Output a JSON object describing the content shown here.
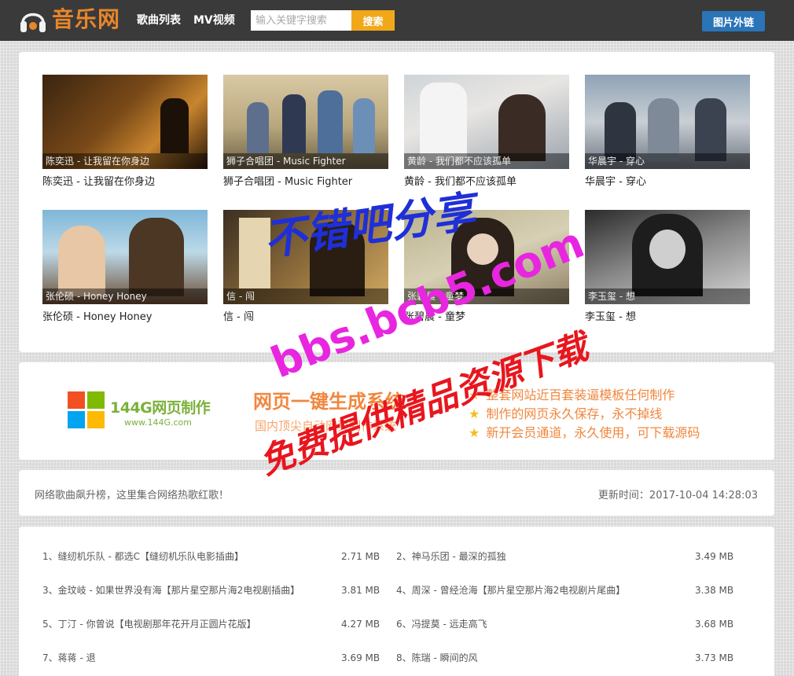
{
  "header": {
    "logo_text": "音乐网",
    "nav": [
      "歌曲列表",
      "MV视频"
    ],
    "search_placeholder": "输入关键字搜索",
    "search_button": "搜索",
    "img_link_button": "图片外链"
  },
  "gallery": [
    {
      "caption": "陈奕迅 - 让我留在你身边",
      "title": "陈奕迅 - 让我留在你身边"
    },
    {
      "caption": "狮子合唱团 - Music Fighter",
      "title": "狮子合唱团 - Music Fighter"
    },
    {
      "caption": "黄龄 - 我们都不应该孤单",
      "title": "黄龄 - 我们都不应该孤单"
    },
    {
      "caption": "华晨宇 - 穿心",
      "title": "华晨宇 - 穿心"
    },
    {
      "caption": "张伦硕 - Honey Honey",
      "title": "张伦硕 - Honey Honey"
    },
    {
      "caption": "信 - 闯",
      "title": "信 - 闯"
    },
    {
      "caption": "张碧晨 - 童梦",
      "title": "张碧晨 - 童梦"
    },
    {
      "caption": "李玉玺 - 想",
      "title": "李玉玺 - 想"
    }
  ],
  "ad": {
    "brand": "144G网页制作",
    "brand_site": "www.144G.com",
    "headline": "网页一键生成系统",
    "sub": "国内顶尖自动网页制作系统",
    "features": [
      "整套网站近百套装逼模板任何制作",
      "制作的网页永久保存，永不掉线",
      "新开会员通道，永久使用，可下载源码"
    ]
  },
  "info": {
    "left": "网络歌曲飙升榜，这里集合网络热歌红歌！",
    "right": "更新时间：2017-10-04 14:28:03"
  },
  "songs": [
    {
      "name": "1、缝纫机乐队 - 都选C【缝纫机乐队电影插曲】",
      "size": "2.71 MB"
    },
    {
      "name": "2、神马乐团 - 最深的孤独",
      "size": "3.49 MB"
    },
    {
      "name": "3、金玟岐 - 如果世界没有海【那片星空那片海2电视剧插曲】",
      "size": "3.81 MB"
    },
    {
      "name": "4、周深 - 曾经沧海【那片星空那片海2电视剧片尾曲】",
      "size": "3.38 MB"
    },
    {
      "name": "5、丁汀 - 你曾说【电视剧那年花开月正圆片花版】",
      "size": "4.27 MB"
    },
    {
      "name": "6、冯提莫 - 远走高飞",
      "size": "3.68 MB"
    },
    {
      "name": "7、蒋蒋 - 退",
      "size": "3.69 MB"
    },
    {
      "name": "8、陈瑞 - 瞬间的风",
      "size": "3.73 MB"
    }
  ],
  "watermarks": [
    "不错吧分享",
    "bbs.bcb5.com",
    "免费提供精品资源下载"
  ],
  "colors": {
    "header_bg": "#3a3a3a",
    "logo": "#e8862a",
    "search_button": "#f0a81a",
    "link_button": "#2a74b8",
    "ad_orange": "#f0873e",
    "ad_green": "#7bb13c"
  }
}
